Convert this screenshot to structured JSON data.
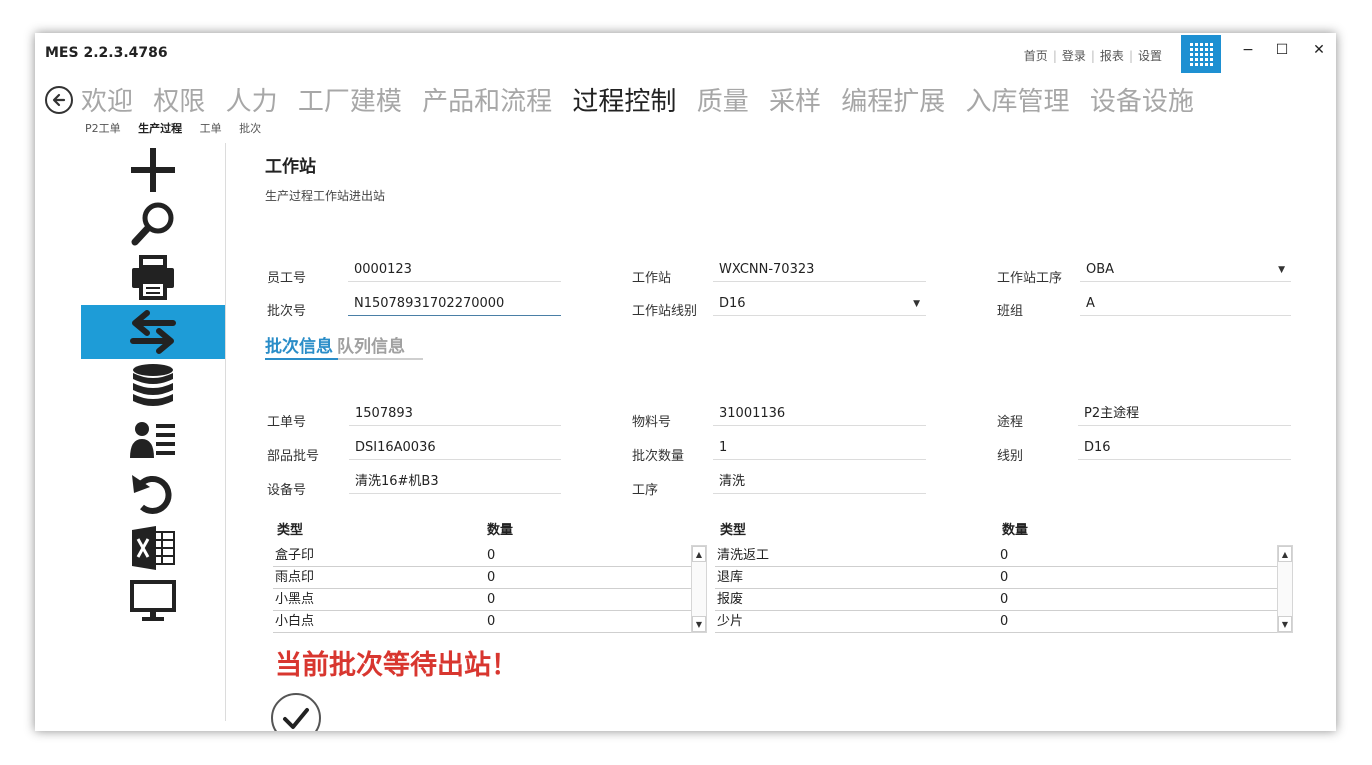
{
  "app": {
    "title": "MES 2.2.3.4786"
  },
  "toplinks": [
    "首页",
    "登录",
    "报表",
    "设置"
  ],
  "window_controls": {
    "minimize": "−",
    "maximize": "☐",
    "close": "✕"
  },
  "main_nav": [
    "欢迎",
    "权限",
    "人力",
    "工厂建模",
    "产品和流程",
    "过程控制",
    "质量",
    "采样",
    "编程扩展",
    "入库管理",
    "设备设施"
  ],
  "main_nav_active": "过程控制",
  "sub_nav": [
    "P2工单",
    "生产过程",
    "工单",
    "批次"
  ],
  "sub_nav_active": "生产过程",
  "sidebar_icons": [
    "plus-icon",
    "search-icon",
    "print-icon",
    "transfer-icon",
    "database-icon",
    "user-list-icon",
    "undo-icon",
    "excel-icon",
    "monitor-icon"
  ],
  "sidebar_active": "transfer-icon",
  "section": {
    "title": "工作站",
    "subtitle": "生产过程工作站进出站"
  },
  "station_form": {
    "employee_label": "员工号",
    "employee_value": "0000123",
    "batch_label": "批次号",
    "batch_value": "N15078931702270000",
    "station_label": "工作站",
    "station_value": "WXCNN-70323",
    "line_label": "工作站线别",
    "line_value": "D16",
    "process_label": "工作站工序",
    "process_value": "OBA",
    "team_label": "班组",
    "team_value": "A"
  },
  "tabs": {
    "batch_info": "批次信息",
    "queue_info": "队列信息"
  },
  "batch_info": {
    "workorder_label": "工单号",
    "workorder_value": "1507893",
    "part_batch_label": "部品批号",
    "part_batch_value": "DSI16A0036",
    "equipment_label": "设备号",
    "equipment_value": "清洗16#机B3",
    "material_label": "物料号",
    "material_value": "31001136",
    "batch_qty_label": "批次数量",
    "batch_qty_value": "1",
    "operation_label": "工序",
    "operation_value": "清洗",
    "route_label": "途程",
    "route_value": "P2主途程",
    "line_label": "线别",
    "line_value": "D16"
  },
  "defect_grid_left": {
    "headers": [
      "类型",
      "数量"
    ],
    "rows": [
      {
        "type": "盒子印",
        "qty": "0"
      },
      {
        "type": "雨点印",
        "qty": "0"
      },
      {
        "type": "小黑点",
        "qty": "0"
      },
      {
        "type": "小白点",
        "qty": "0"
      }
    ]
  },
  "defect_grid_right": {
    "headers": [
      "类型",
      "数量"
    ],
    "rows": [
      {
        "type": "清洗返工",
        "qty": "0"
      },
      {
        "type": "退库",
        "qty": "0"
      },
      {
        "type": "报废",
        "qty": "0"
      },
      {
        "type": "少片",
        "qty": "0"
      }
    ]
  },
  "scroll_arrows": {
    "up": "▲",
    "down": "▼",
    "dropdown": "▼"
  },
  "status_message": "当前批次等待出站！"
}
